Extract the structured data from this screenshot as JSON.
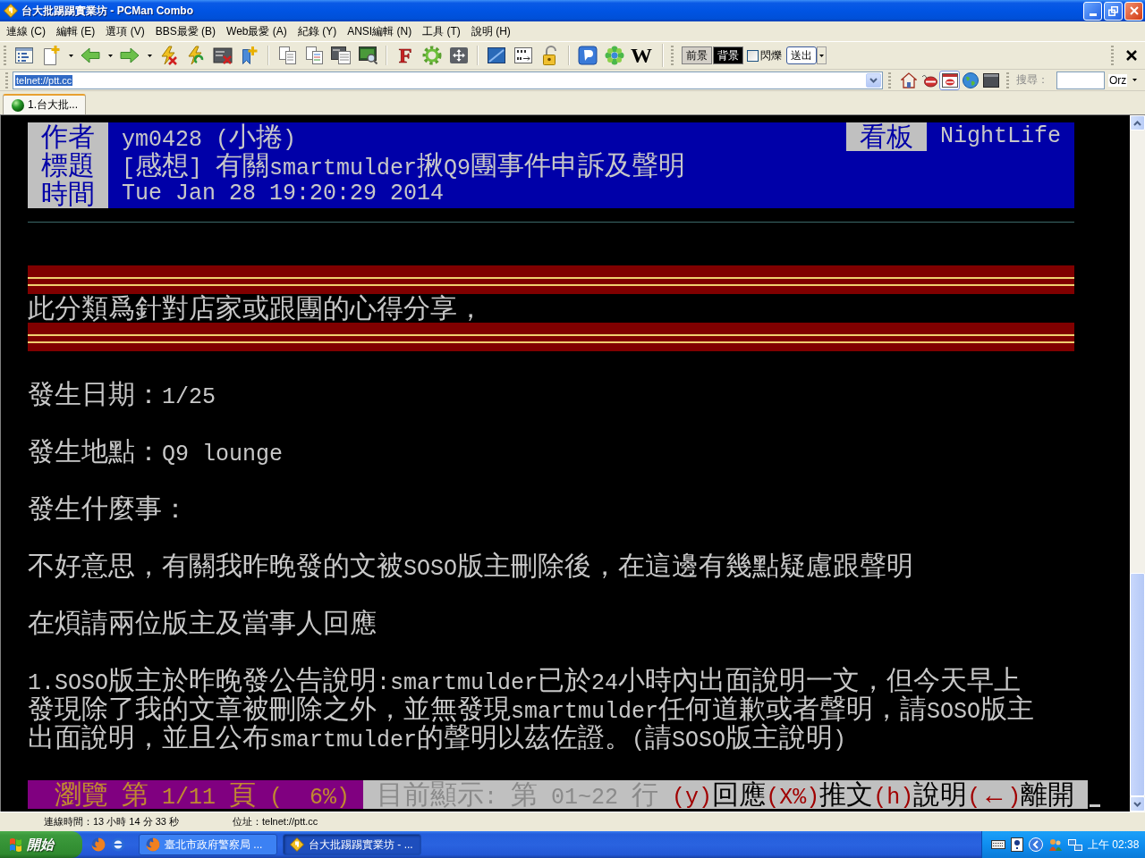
{
  "window": {
    "title": "台大批踢踢實業坊 - PCMan Combo"
  },
  "menu": [
    "連線 (C)",
    "編輯 (E)",
    "選項 (V)",
    "BBS最愛 (B)",
    "Web最愛 (A)",
    "紀錄 (Y)",
    "ANSI編輯 (N)",
    "工具 (T)",
    "說明 (H)"
  ],
  "toolbar": {
    "glyph_buttons": [
      "F",
      "W"
    ],
    "foreground_button": "前景",
    "background_button": "背景",
    "blink": {
      "label": "閃爍",
      "checked": false
    },
    "send_button": "送出"
  },
  "address_bar": {
    "value": "telnet://ptt.cc",
    "highlighted": true
  },
  "quick_buttons": [
    {
      "pressed": false
    },
    {
      "pressed": false
    },
    {
      "pressed": true
    },
    {
      "pressed": false
    },
    {
      "pressed": false
    }
  ],
  "search": {
    "label": "搜尋：",
    "engine": "Orz"
  },
  "tabs": [
    {
      "label": "1.台大批...",
      "selected": true
    }
  ],
  "terminal": {
    "header": {
      "fields": [
        {
          "label": "作者",
          "value": "ym0428 (小捲)"
        },
        {
          "label": "標題",
          "value": "[感想] 有關smartmulder揪Q9團事件申訴及聲明"
        },
        {
          "label": "時間",
          "value": "Tue Jan 28 19:20:29 2014"
        }
      ],
      "board": {
        "label": "看板",
        "value": "NightLife"
      }
    },
    "lines": [
      {
        "kind": "rule"
      },
      {
        "kind": "blank"
      },
      {
        "kind": "banner"
      },
      {
        "kind": "text",
        "text": "此分類爲針對店家或跟團的心得分享，"
      },
      {
        "kind": "banner"
      },
      {
        "kind": "blank"
      },
      {
        "kind": "text",
        "text": "發生日期：1/25"
      },
      {
        "kind": "blank"
      },
      {
        "kind": "text",
        "text": "發生地點：Q9 lounge"
      },
      {
        "kind": "blank"
      },
      {
        "kind": "text",
        "text": "發生什麼事："
      },
      {
        "kind": "blank"
      },
      {
        "kind": "text",
        "text": "不好意思，有關我昨晚發的文被SOSO版主刪除後，在這邊有幾點疑慮跟聲明"
      },
      {
        "kind": "blank"
      },
      {
        "kind": "text",
        "text": "在煩請兩位版主及當事人回應"
      },
      {
        "kind": "blank"
      },
      {
        "kind": "text",
        "text": "1.SOSO版主於昨晚發公告說明:smartmulder已於24小時內出面說明一文，但今天早上"
      },
      {
        "kind": "text",
        "text": "發現除了我的文章被刪除之外，並無發現smartmulder任何道歉或者聲明，請SOSO版主"
      },
      {
        "kind": "text",
        "text": "出面說明，並且公布smartmulder的聲明以茲佐證。(請SOSO版主說明)"
      },
      {
        "kind": "blank"
      }
    ],
    "pager": {
      "position": "瀏覽 第 1/11 頁 (  6%)",
      "range": "目前顯示: 第 01~22 行",
      "keys": [
        {
          "key": "(y)",
          "action": "回應"
        },
        {
          "key": "(X%)",
          "action": "推文"
        },
        {
          "key": "(h)",
          "action": "說明"
        },
        {
          "key": "(←)",
          "action": "離開"
        }
      ]
    }
  },
  "status_bar": {
    "connection_time": "連線時間：13 小時 14 分 33 秒",
    "address": "位址：telnet://ptt.cc"
  },
  "taskbar": {
    "start": "開始",
    "tasks": [
      {
        "label": "臺北市政府警察局 ...",
        "selected": false
      },
      {
        "label": "台大批踢踢實業坊 - ...",
        "selected": true
      }
    ],
    "clock": "上午 02:38"
  }
}
